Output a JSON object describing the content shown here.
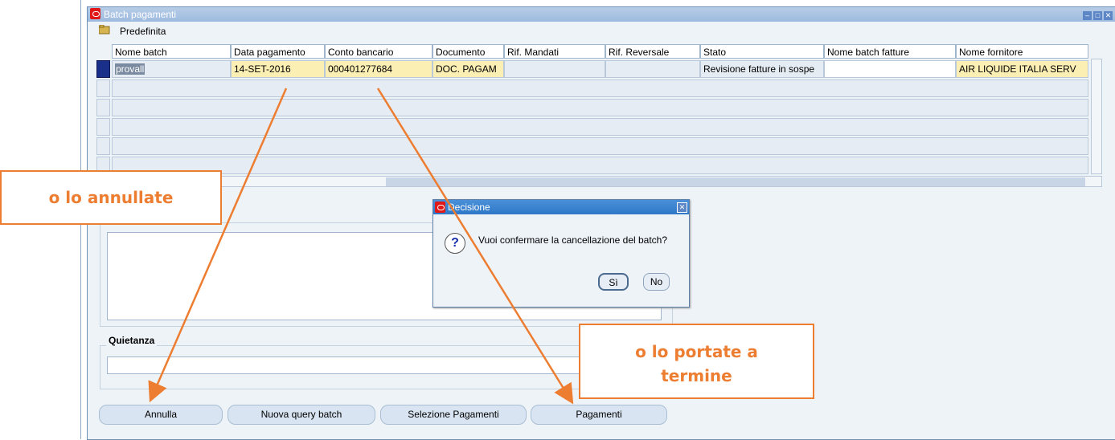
{
  "window": {
    "title": "Batch pagamenti",
    "view_label": "Predefinita"
  },
  "table": {
    "columns": [
      "Nome batch",
      "Data pagamento",
      "Conto bancario",
      "Documento",
      "Rif. Mandati",
      "Rif. Reversale",
      "Stato",
      "Nome batch fatture",
      "Nome fornitore"
    ],
    "row": [
      "provall",
      "14-SET-2016",
      "000401277684",
      "DOC. PAGAM",
      "",
      "",
      "Revisione fatture in sospe",
      "",
      "AIR LIQUIDE ITALIA SERV"
    ]
  },
  "section": {
    "quietanza": "Quietanza"
  },
  "buttons": {
    "annulla": "Annulla",
    "nuova_query": "Nuova query batch",
    "selezione": "Selezione Pagamenti",
    "pagamenti": "Pagamenti"
  },
  "dialog": {
    "title": "Decisione",
    "message": "Vuoi confermare la cancellazione del batch?",
    "yes": "Sì",
    "no": "No"
  },
  "annotations": {
    "left": "o lo annullate",
    "right_line1": "o lo portate a",
    "right_line2": "termine"
  },
  "colors": {
    "accent": "#ed7d31",
    "selected_row": "#1a2f8a",
    "required_field": "#fcefb3"
  }
}
